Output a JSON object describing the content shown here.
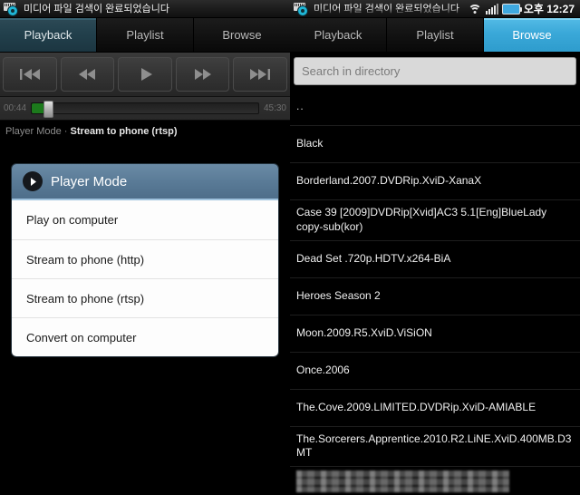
{
  "left": {
    "statusbar": {
      "notification_icon": "media-scanner-icon",
      "ticker": "미디어 파일 검색이 완료되었습니다"
    },
    "tabs": [
      {
        "label": "Playback",
        "selected": true
      },
      {
        "label": "Playlist",
        "selected": false
      },
      {
        "label": "Browse",
        "selected": false
      }
    ],
    "transport": [
      {
        "name": "skip-previous-button",
        "icon": "skip-previous-icon"
      },
      {
        "name": "rewind-button",
        "icon": "rewind-icon"
      },
      {
        "name": "play-button",
        "icon": "play-icon"
      },
      {
        "name": "fast-forward-button",
        "icon": "fast-forward-icon"
      },
      {
        "name": "skip-next-button",
        "icon": "skip-next-icon"
      }
    ],
    "seek": {
      "elapsed": "00:44",
      "duration": "45:30",
      "progress_percent": 3,
      "thumb_percent": 4,
      "fill_color": "#1c7a1c"
    },
    "mode_line": {
      "label": "Player Mode ·",
      "value": "Stream to phone (rtsp)"
    },
    "dialog": {
      "title": "Player Mode",
      "header_icon": "chevron-right-circle-icon",
      "items": [
        "Play on computer",
        "Stream to phone (http)",
        "Stream to phone (rtsp)",
        "Convert on computer"
      ]
    }
  },
  "right": {
    "statusbar": {
      "notification_icon": "media-scanner-icon",
      "ticker": "미디어 파일 검색이 완료되었습니다",
      "icons": [
        "wifi-icon",
        "signal-icon",
        "battery-icon"
      ],
      "clock": "오후 12:27"
    },
    "tabs": [
      {
        "label": "Playback",
        "selected": false
      },
      {
        "label": "Playlist",
        "selected": false
      },
      {
        "label": "Browse",
        "selected": true
      }
    ],
    "search": {
      "value": "",
      "placeholder": "Search in directory"
    },
    "files": [
      {
        "name": "..",
        "censored": false
      },
      {
        "name": "Black",
        "censored": false
      },
      {
        "name": "Borderland.2007.DVDRip.XviD-XanaX",
        "censored": false
      },
      {
        "name": "Case 39 [2009]DVDRip[Xvid]AC3 5.1[Eng]BlueLady copy-sub(kor)",
        "censored": false
      },
      {
        "name": "Dead Set .720p.HDTV.x264-BiA",
        "censored": false
      },
      {
        "name": "Heroes Season 2",
        "censored": false
      },
      {
        "name": "Moon.2009.R5.XviD.ViSiON",
        "censored": false
      },
      {
        "name": "Once.2006",
        "censored": false
      },
      {
        "name": "The.Cove.2009.LIMITED.DVDRip.XviD-AMIABLE",
        "censored": false
      },
      {
        "name": "The.Sorcerers.Apprentice.2010.R2.LiNE.XviD.400MB.D3MT",
        "censored": false
      },
      {
        "name": "",
        "censored": true
      }
    ]
  },
  "colors": {
    "tab_selected_dark": "#22404c",
    "tab_selected_bright": "#3aa8d8",
    "dialog_header": "#5a7b97",
    "seek_fill": "#1c7a1c",
    "battery": "#3fa9e0"
  }
}
